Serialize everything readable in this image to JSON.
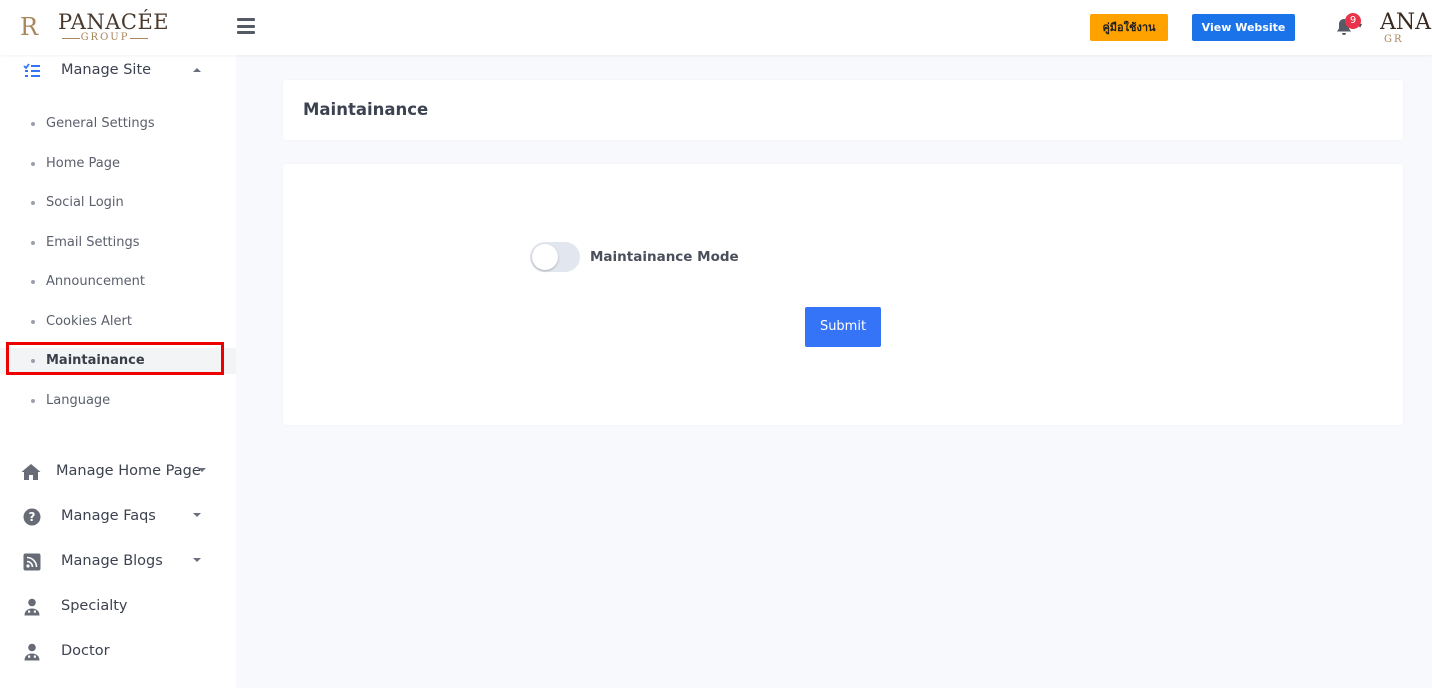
{
  "header": {
    "logo_mark": "R",
    "logo_name": "PANACÉE",
    "logo_sub": "GROUP",
    "manual_button": "คู่มือใช้งาน",
    "view_website_button": "View Website",
    "notification_count": "9",
    "user_logo_name": "ANA",
    "user_logo_sub": "GR"
  },
  "sidebar": {
    "manage_site": {
      "label": "Manage Site",
      "items": [
        {
          "label": "General Settings"
        },
        {
          "label": "Home Page"
        },
        {
          "label": "Social Login"
        },
        {
          "label": "Email Settings"
        },
        {
          "label": "Announcement"
        },
        {
          "label": "Cookies Alert"
        },
        {
          "label": "Maintainance",
          "active": true
        },
        {
          "label": "Language"
        }
      ]
    },
    "groups": [
      {
        "label": "Manage Home Page",
        "icon": "home-icon"
      },
      {
        "label": "Manage Faqs",
        "icon": "question-circle-icon"
      },
      {
        "label": "Manage Blogs",
        "icon": "rss-icon"
      },
      {
        "label": "Specialty",
        "icon": "user-doctor-icon"
      },
      {
        "label": "Doctor",
        "icon": "user-doctor-icon"
      }
    ]
  },
  "main": {
    "page_title": "Maintainance",
    "maintenance_mode": {
      "label": "Maintainance Mode",
      "enabled": false
    },
    "submit_label": "Submit"
  },
  "colors": {
    "manual_button_bg": "#ffa200",
    "view_button_bg": "#1a73e8",
    "submit_bg": "#3574f6",
    "badge_bg": "#e8334a",
    "highlight": "#ee0000"
  }
}
